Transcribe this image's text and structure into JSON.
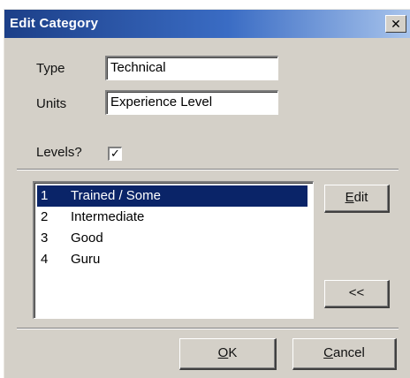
{
  "window": {
    "title": "Edit Category",
    "close_glyph": "✕"
  },
  "form": {
    "type_label": "Type",
    "type_value": "Technical",
    "units_label": "Units",
    "units_value": "Experience Level",
    "levels_label": "Levels?",
    "levels_checked": true,
    "check_glyph": "✓"
  },
  "levels_list": {
    "items": [
      {
        "num": "1",
        "label": "Trained / Some",
        "selected": true
      },
      {
        "num": "2",
        "label": "Intermediate",
        "selected": false
      },
      {
        "num": "3",
        "label": "Good",
        "selected": false
      },
      {
        "num": "4",
        "label": "Guru",
        "selected": false
      }
    ]
  },
  "buttons": {
    "edit_mnemonic": "E",
    "edit_rest": "dit",
    "back_label": "<<",
    "ok_mnemonic": "O",
    "ok_rest": "K",
    "cancel_mnemonic": "C",
    "cancel_rest": "ancel"
  },
  "colors": {
    "title_gradient_start": "#1c3f88",
    "title_gradient_end": "#a8c4ec",
    "selection": "#0a2468",
    "face": "#d4d0c8"
  }
}
